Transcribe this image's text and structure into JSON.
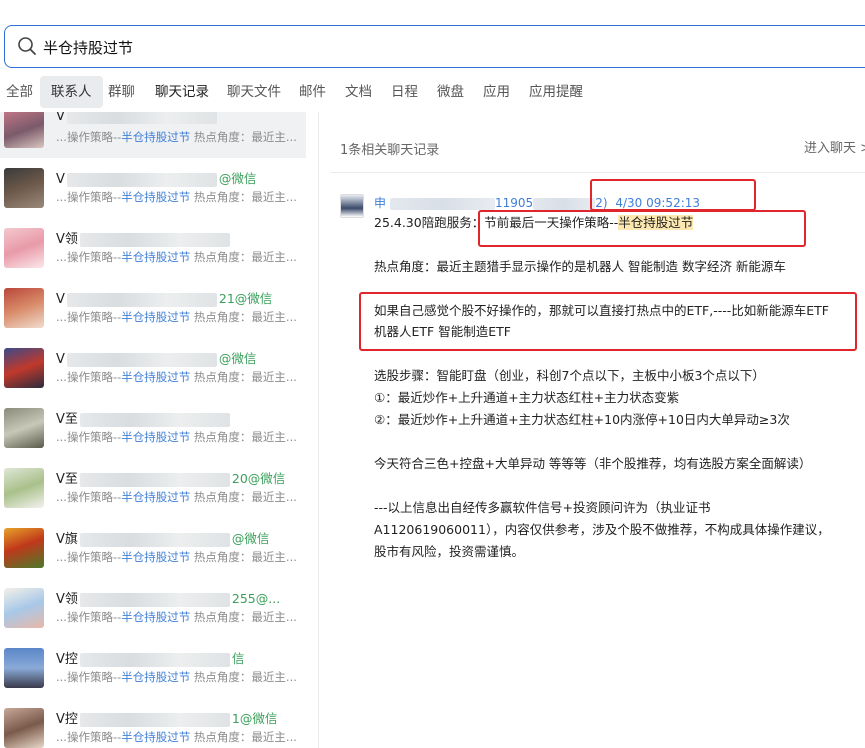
{
  "search": {
    "query": "半仓持股过节"
  },
  "tabs": [
    {
      "label": "全部"
    },
    {
      "label": "联系人"
    },
    {
      "label": "群聊"
    },
    {
      "label": "聊天记录"
    },
    {
      "label": "聊天文件"
    },
    {
      "label": "邮件"
    },
    {
      "label": "文档"
    },
    {
      "label": "日程"
    },
    {
      "label": "微盘"
    },
    {
      "label": "应用"
    },
    {
      "label": "应用提醒"
    }
  ],
  "contacts": [
    {
      "prefix": "V",
      "tag": "",
      "snippet_pre": "...操作策略--",
      "snippet_hl": "半仓持股过节",
      "snippet_post": " 热点角度：最近主..."
    },
    {
      "prefix": "V",
      "tag": "@微信",
      "snippet_pre": "...操作策略--",
      "snippet_hl": "半仓持股过节",
      "snippet_post": " 热点角度：最近主..."
    },
    {
      "prefix": "V领",
      "tag": "",
      "snippet_pre": "...操作策略--",
      "snippet_hl": "半仓持股过节",
      "snippet_post": " 热点角度：最近主..."
    },
    {
      "prefix": "V",
      "tag": "21@微信",
      "snippet_pre": "...操作策略--",
      "snippet_hl": "半仓持股过节",
      "snippet_post": " 热点角度：最近主..."
    },
    {
      "prefix": "V",
      "tag": "@微信",
      "snippet_pre": "...操作策略--",
      "snippet_hl": "半仓持股过节",
      "snippet_post": " 热点角度：最近主..."
    },
    {
      "prefix": "V至",
      "tag": "",
      "snippet_pre": "...操作策略--",
      "snippet_hl": "半仓持股过节",
      "snippet_post": " 热点角度：最近主..."
    },
    {
      "prefix": "V至",
      "tag": "20@微信",
      "snippet_pre": "...操作策略--",
      "snippet_hl": "半仓持股过节",
      "snippet_post": " 热点角度：最近主..."
    },
    {
      "prefix": "V旗",
      "tag": "@微信",
      "snippet_pre": "...操作策略--",
      "snippet_hl": "半仓持股过节",
      "snippet_post": " 热点角度：最近主..."
    },
    {
      "prefix": "V领",
      "tag": "255@...",
      "snippet_pre": "...操作策略--",
      "snippet_hl": "半仓持股过节",
      "snippet_post": " 热点角度：最近主..."
    },
    {
      "prefix": "V控",
      "tag": "信",
      "snippet_pre": "...操作策略--",
      "snippet_hl": "半仓持股过节",
      "snippet_post": " 热点角度：最近主..."
    },
    {
      "prefix": "V控",
      "tag": "1@微信",
      "snippet_pre": "...操作策略--",
      "snippet_hl": "半仓持股过节",
      "snippet_post": " 热点角度：最近主..."
    }
  ],
  "result": {
    "count": "1条相关聊天记录",
    "enter_chat": "进入聊天 >",
    "sender_prefix": "申",
    "sender_mid": "11905",
    "sender_end": "2)",
    "timestamp": "4/30 09:52:13",
    "line1_pre": "25.4.30陪跑服务：",
    "line1_mid": "节前最后一天操作策略--",
    "line1_hl": "半仓持股过节",
    "line2": "热点角度：最近主题猎手显示操作的是机器人  智能制造   数字经济   新能源车",
    "line3": "如果自己感觉个股不好操作的，那就可以直接打热点中的ETF,----比如新能源车ETF",
    "line4": "机器人ETF   智能制造ETF",
    "line5": "选股步骤：智能盯盘（创业，科创7个点以下，主板中小板3个点以下）",
    "line6": "①：最近炒作+上升通道+主力状态红柱+主力状态变紫",
    "line7": "②：最近炒作+上升通道+主力状态红柱+10内涨停+10日内大单异动≥3次",
    "line8": "今天符合三色+控盘+大单异动  等等等（非个股推荐，均有选股方案全面解读）",
    "line9": "---以上信息出自经传多赢软件信号+投资顾问许为（执业证书",
    "line10": "A1120619060011），内容仅供参考，涉及个股不做推荐，不构成具体操作建议，",
    "line11": "股市有风险，投资需谨慎。"
  }
}
